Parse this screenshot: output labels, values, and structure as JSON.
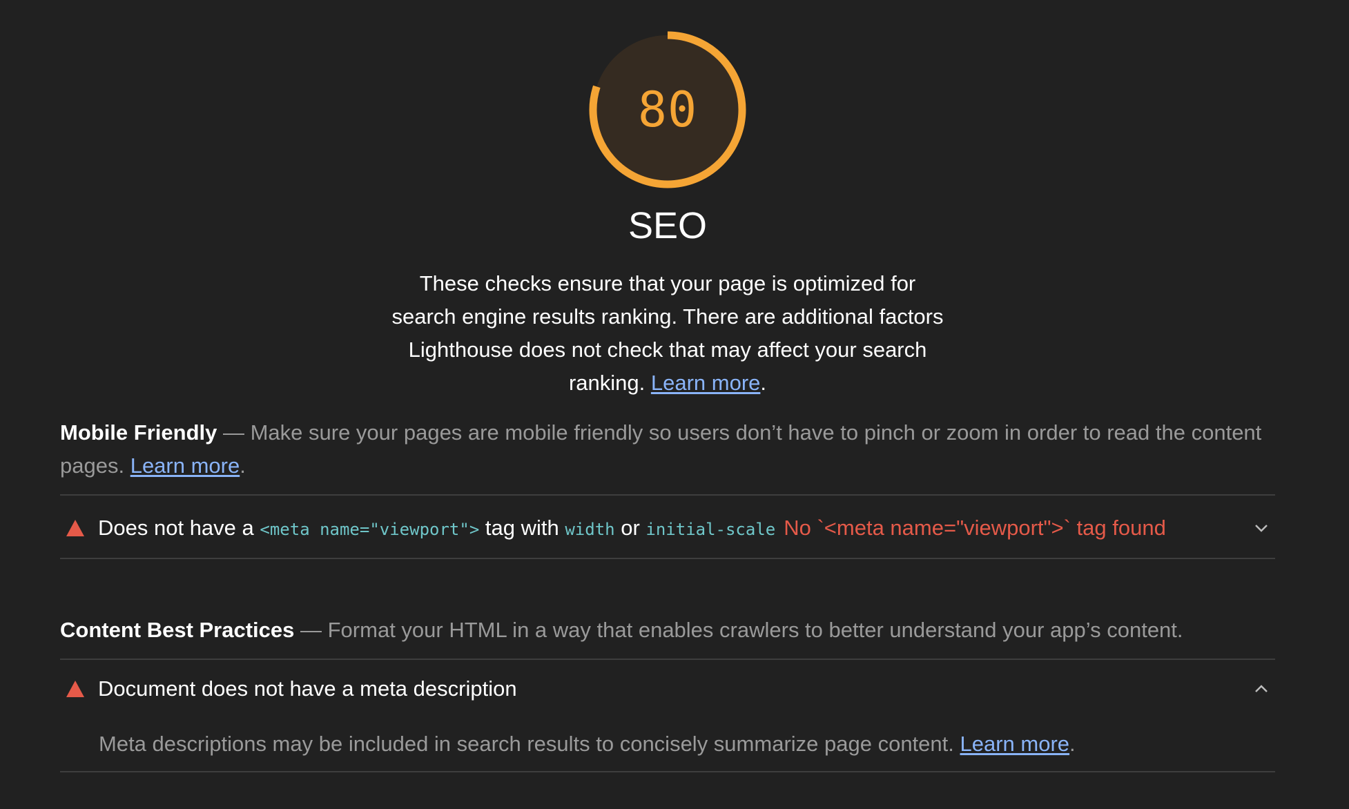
{
  "gauge": {
    "score": "80",
    "fraction": 0.8,
    "color": "#f5a535",
    "fill_color": "#352b21"
  },
  "category": {
    "title": "SEO",
    "description": "These checks ensure that your page is optimized for search engine results ranking. There are additional factors Lighthouse does not check that may affect your search ranking.",
    "learn_more": "Learn more",
    "period": "."
  },
  "groups": {
    "mobile_friendly": {
      "title": "Mobile Friendly",
      "separator": " — ",
      "description": "Make sure your pages are mobile friendly so users don’t have to pinch or zoom in order to read the content pages.",
      "learn_more": "Learn more",
      "period": ".",
      "audit": {
        "title_part1": "Does not have a ",
        "code1": "<meta name=\"viewport\">",
        "title_part2": " tag with ",
        "code2": "width",
        "title_part3": " or ",
        "code3": "initial-scale",
        "display_value": "No `<meta name=\"viewport\">` tag found",
        "icon": "fail-triangle-icon",
        "chevron": "chevron-down-icon"
      }
    },
    "content_best_practices": {
      "title": "Content Best Practices",
      "separator": " — ",
      "description": "Format your HTML in a way that enables crawlers to better understand your app’s content.",
      "audit": {
        "title": "Document does not have a meta description",
        "icon": "fail-triangle-icon",
        "chevron": "chevron-up-icon",
        "description": "Meta descriptions may be included in search results to concisely summarize page content.",
        "learn_more": "Learn more",
        "period": "."
      }
    }
  },
  "colors": {
    "background": "#212121",
    "fail": "#e55a49",
    "average": "#f5a535",
    "link": "#8ab4f8",
    "code": "#6fc6c9",
    "muted_text": "#9a9a9a",
    "divider": "#3e3e3e"
  }
}
